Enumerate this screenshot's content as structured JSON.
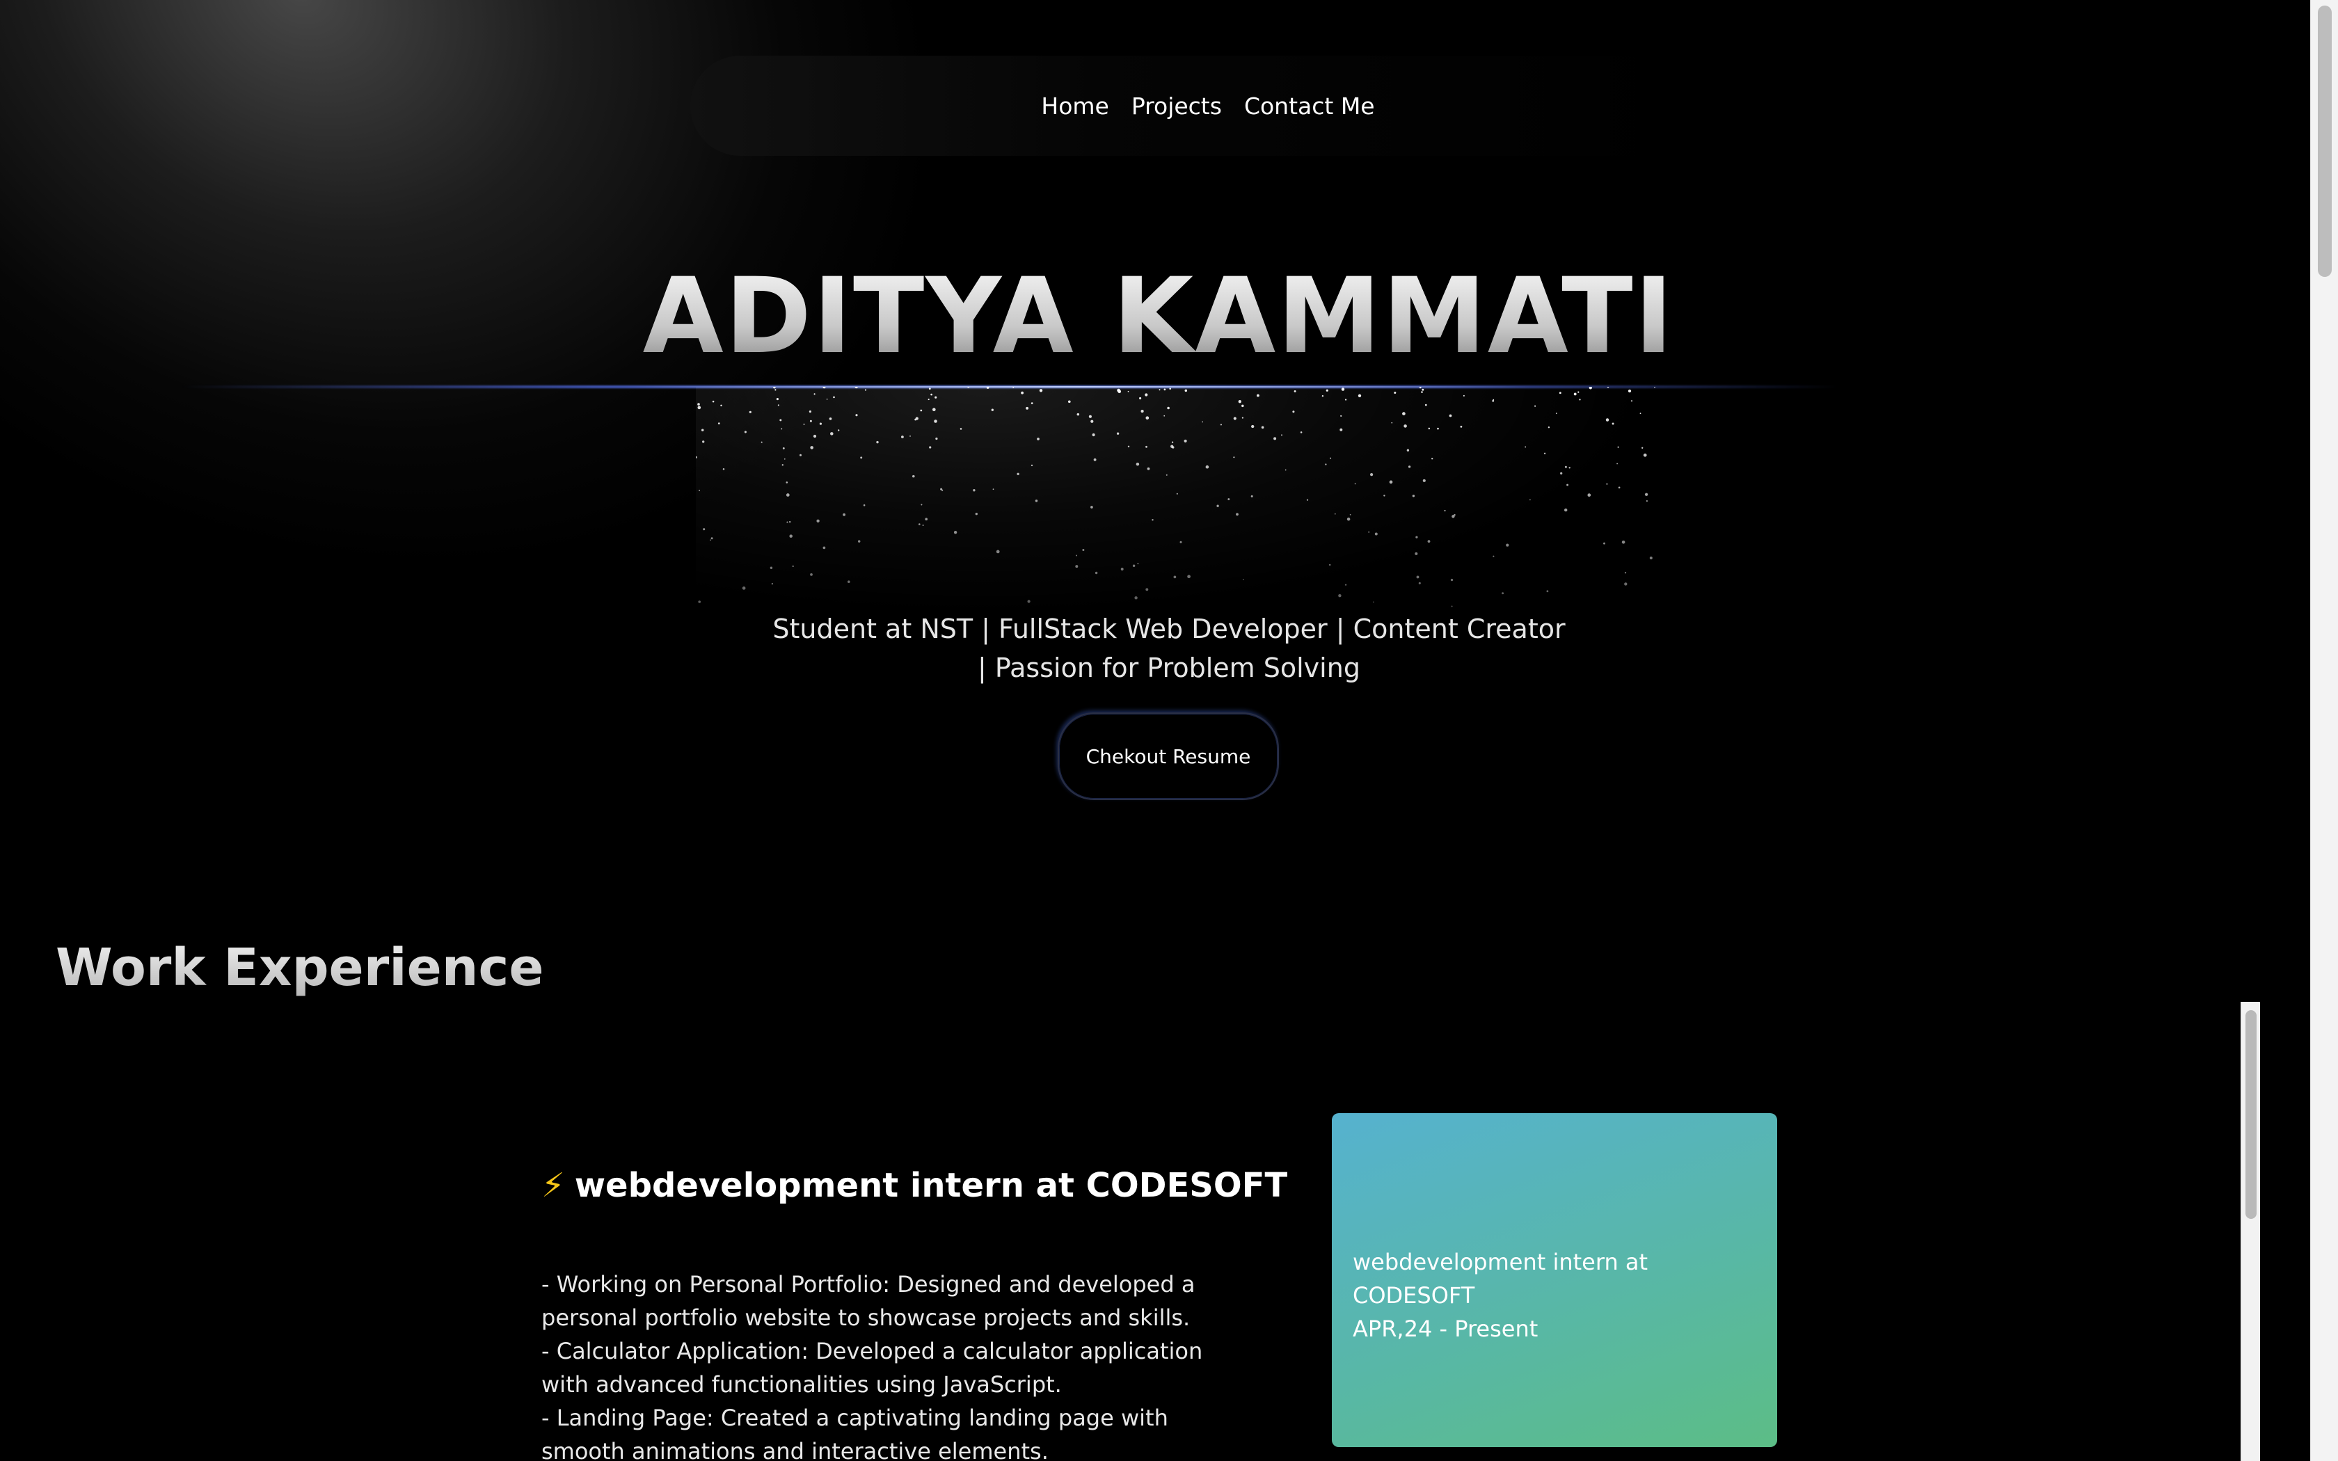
{
  "nav": {
    "items": [
      "Home",
      "Projects",
      "Contact Me"
    ]
  },
  "hero": {
    "name": "ADITYA KAMMATI",
    "subtitle_line1": "Student at NST | FullStack Web Developer | Content Creator",
    "subtitle_line2": "| Passion for Problem Solving",
    "resume_button": "Chekout Resume"
  },
  "work": {
    "section_title": "Work Experience",
    "entries": [
      {
        "icon": "lightning-icon",
        "icon_glyph": "⚡",
        "title": "webdevelopment intern at CODESOFT",
        "description": [
          "- Working on Personal Portfolio: Designed and developed a personal portfolio website to showcase projects and skills.",
          "- Calculator Application: Developed a calculator application with advanced functionalities using JavaScript.",
          "- Landing Page: Created a captivating landing page with smooth animations and interactive elements."
        ],
        "card_title": "webdevelopment intern at CODESOFT",
        "card_period": "APR,24 - Present"
      }
    ]
  },
  "colors": {
    "background": "#000000",
    "card_gradient_start": "#56b2cf",
    "card_gradient_end": "#5cbd86",
    "accent_line": "#7890ff",
    "bolt": "#f5c518"
  }
}
